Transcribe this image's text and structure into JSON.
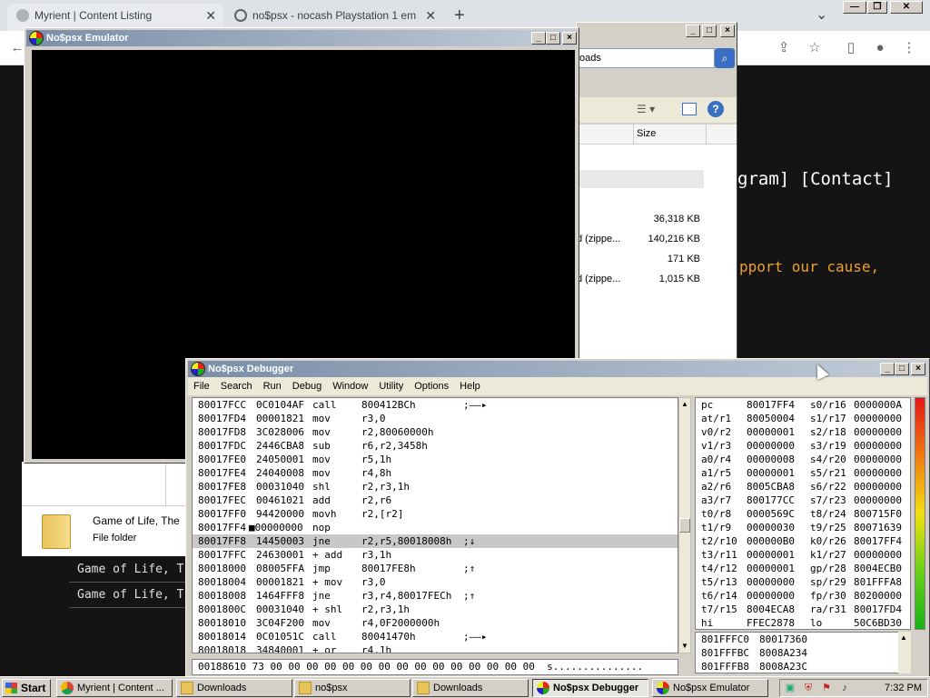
{
  "browser": {
    "tabs": [
      {
        "label": "Myrient | Content Listing",
        "close": "✕"
      },
      {
        "label": "no$psx - nocash Playstation 1 em",
        "close": "✕"
      }
    ],
    "new_tab": "+",
    "tab_menu": "⌄",
    "back": "←",
    "toolbar_icons": {
      "share": "⇪",
      "star": "☆",
      "sidepanel": "▯",
      "profile": "●",
      "menu": "⋮"
    },
    "window_controls": {
      "minimize": "—",
      "restore": "❐",
      "close": "✕"
    },
    "page": {
      "nav_text": "gram] [Contact]",
      "support_text": "pport our cause,",
      "rows": [
        "Game of Life, T",
        "Game of Life, T"
      ]
    }
  },
  "explorer": {
    "address": "oads",
    "search_icon": "⌕",
    "column": "Size",
    "rows": [
      {
        "name": "",
        "size": "36,318 KB"
      },
      {
        "name": "d (zippe...",
        "size": "140,216 KB"
      },
      {
        "name": "",
        "size": "171 KB"
      },
      {
        "name": "d (zippe...",
        "size": "1,015 KB"
      }
    ],
    "folder_name": "Game of Life, The",
    "folder_type": "File folder"
  },
  "emulator": {
    "title": "No$psx Emulator"
  },
  "debugger": {
    "title": "No$psx Debugger",
    "menu": [
      "File",
      "Search",
      "Run",
      "Debug",
      "Window",
      "Utility",
      "Options",
      "Help"
    ],
    "disasm": [
      {
        "addr": "80017FCC",
        "op": "0C0104AF",
        "mn": "call",
        "args": "800412BCh",
        "arrow": ";——▸"
      },
      {
        "addr": "80017FD4",
        "op": "00001821",
        "mn": "mov",
        "args": "r3,0",
        "arrow": ""
      },
      {
        "addr": "80017FD8",
        "op": "3C028006",
        "mn": "mov",
        "args": "r2,80060000h",
        "arrow": ""
      },
      {
        "addr": "80017FDC",
        "op": "2446CBA8",
        "mn": "sub",
        "args": "r6,r2,3458h",
        "arrow": ""
      },
      {
        "addr": "80017FE0",
        "op": "24050001",
        "mn": "mov",
        "args": "r5,1h",
        "arrow": ""
      },
      {
        "addr": "80017FE4",
        "op": "24040008",
        "mn": "mov",
        "args": "r4,8h",
        "arrow": ""
      },
      {
        "addr": "80017FE8",
        "op": "00031040",
        "mn": "shl",
        "args": "r2,r3,1h",
        "arrow": ""
      },
      {
        "addr": "80017FEC",
        "op": "00461021",
        "mn": "add",
        "args": "r2,r6",
        "arrow": ""
      },
      {
        "addr": "80017FF0",
        "op": "94420000",
        "mn": "movh",
        "args": "r2,[r2]",
        "arrow": ""
      },
      {
        "addr": "80017FF4",
        "op": "■00000000",
        "mn": "nop",
        "args": "",
        "arrow": ""
      },
      {
        "addr": "80017FF8",
        "op": "14450003",
        "mn": "jne",
        "args": "r2,r5,80018008h",
        "arrow": ";↓"
      },
      {
        "addr": "80017FFC",
        "op": "24630001",
        "mn": "+ add",
        "args": "r3,1h",
        "arrow": ""
      },
      {
        "addr": "80018000",
        "op": "08005FFA",
        "mn": "jmp",
        "args": "80017FE8h",
        "arrow": ";↑"
      },
      {
        "addr": "80018004",
        "op": "00001821",
        "mn": "+ mov",
        "args": "r3,0",
        "arrow": ""
      },
      {
        "addr": "80018008",
        "op": "1464FFF8",
        "mn": "jne",
        "args": "r3,r4,80017FECh",
        "arrow": ";↑"
      },
      {
        "addr": "8001800C",
        "op": "00031040",
        "mn": "+ shl",
        "args": "r2,r3,1h",
        "arrow": ""
      },
      {
        "addr": "80018010",
        "op": "3C04F200",
        "mn": "mov",
        "args": "r4,0F2000000h",
        "arrow": ""
      },
      {
        "addr": "80018014",
        "op": "0C01051C",
        "mn": "call",
        "args": "80041470h",
        "arrow": ";——▸"
      },
      {
        "addr": "80018018",
        "op": "34840001",
        "mn": "+ or",
        "args": "r4,1h",
        "arrow": ""
      }
    ],
    "registers": [
      [
        "pc",
        "80017FF4",
        "s0/r16",
        "0000000A"
      ],
      [
        "at/r1",
        "80050004",
        "s1/r17",
        "00000000"
      ],
      [
        "v0/r2",
        "00000001",
        "s2/r18",
        "00000000"
      ],
      [
        "v1/r3",
        "00000000",
        "s3/r19",
        "00000000"
      ],
      [
        "a0/r4",
        "00000008",
        "s4/r20",
        "00000000"
      ],
      [
        "a1/r5",
        "00000001",
        "s5/r21",
        "00000000"
      ],
      [
        "a2/r6",
        "8005CBA8",
        "s6/r22",
        "00000000"
      ],
      [
        "a3/r7",
        "800177CC",
        "s7/r23",
        "00000000"
      ],
      [
        "t0/r8",
        "0000569C",
        "t8/r24",
        "800715F0"
      ],
      [
        "t1/r9",
        "00000030",
        "t9/r25",
        "80071639"
      ],
      [
        "t2/r10",
        "000000B0",
        "k0/r26",
        "80017FF4"
      ],
      [
        "t3/r11",
        "00000001",
        "k1/r27",
        "00000000"
      ],
      [
        "t4/r12",
        "00000001",
        "gp/r28",
        "8004ECB0"
      ],
      [
        "t5/r13",
        "00000000",
        "sp/r29",
        "801FFFA8"
      ],
      [
        "t6/r14",
        "00000000",
        "fp/r30",
        "80200000"
      ],
      [
        "t7/r15",
        "8004ECA8",
        "ra/r31",
        "80017FD4"
      ],
      [
        "hi",
        "FFEC2878",
        "lo",
        "50C6BD30"
      ]
    ],
    "stack": [
      [
        "801FFFC0",
        "80017360"
      ],
      [
        "801FFFBC",
        "8008A234"
      ],
      [
        "801FFFB8",
        "8008A23C"
      ]
    ],
    "hexdump": "00188610 73 00 00 00 00 00 00 00 00 00 00 00 00 00 00 00  s..............."
  },
  "taskbar": {
    "start": "Start",
    "buttons": [
      {
        "label": "Myrient | Content ..."
      },
      {
        "label": "Downloads"
      },
      {
        "label": "no$psx"
      },
      {
        "label": "Downloads"
      },
      {
        "label": "No$psx Debugger"
      },
      {
        "label": "No$psx Emulator"
      }
    ],
    "clock": "7:32 PM"
  },
  "colors": {
    "page_bg": "#141414",
    "page_text_white": "#ffffff",
    "page_text_orange": "#f0a030",
    "titlebar_active": "#7a8ea9",
    "highlight_row": "#c8c8c8"
  }
}
